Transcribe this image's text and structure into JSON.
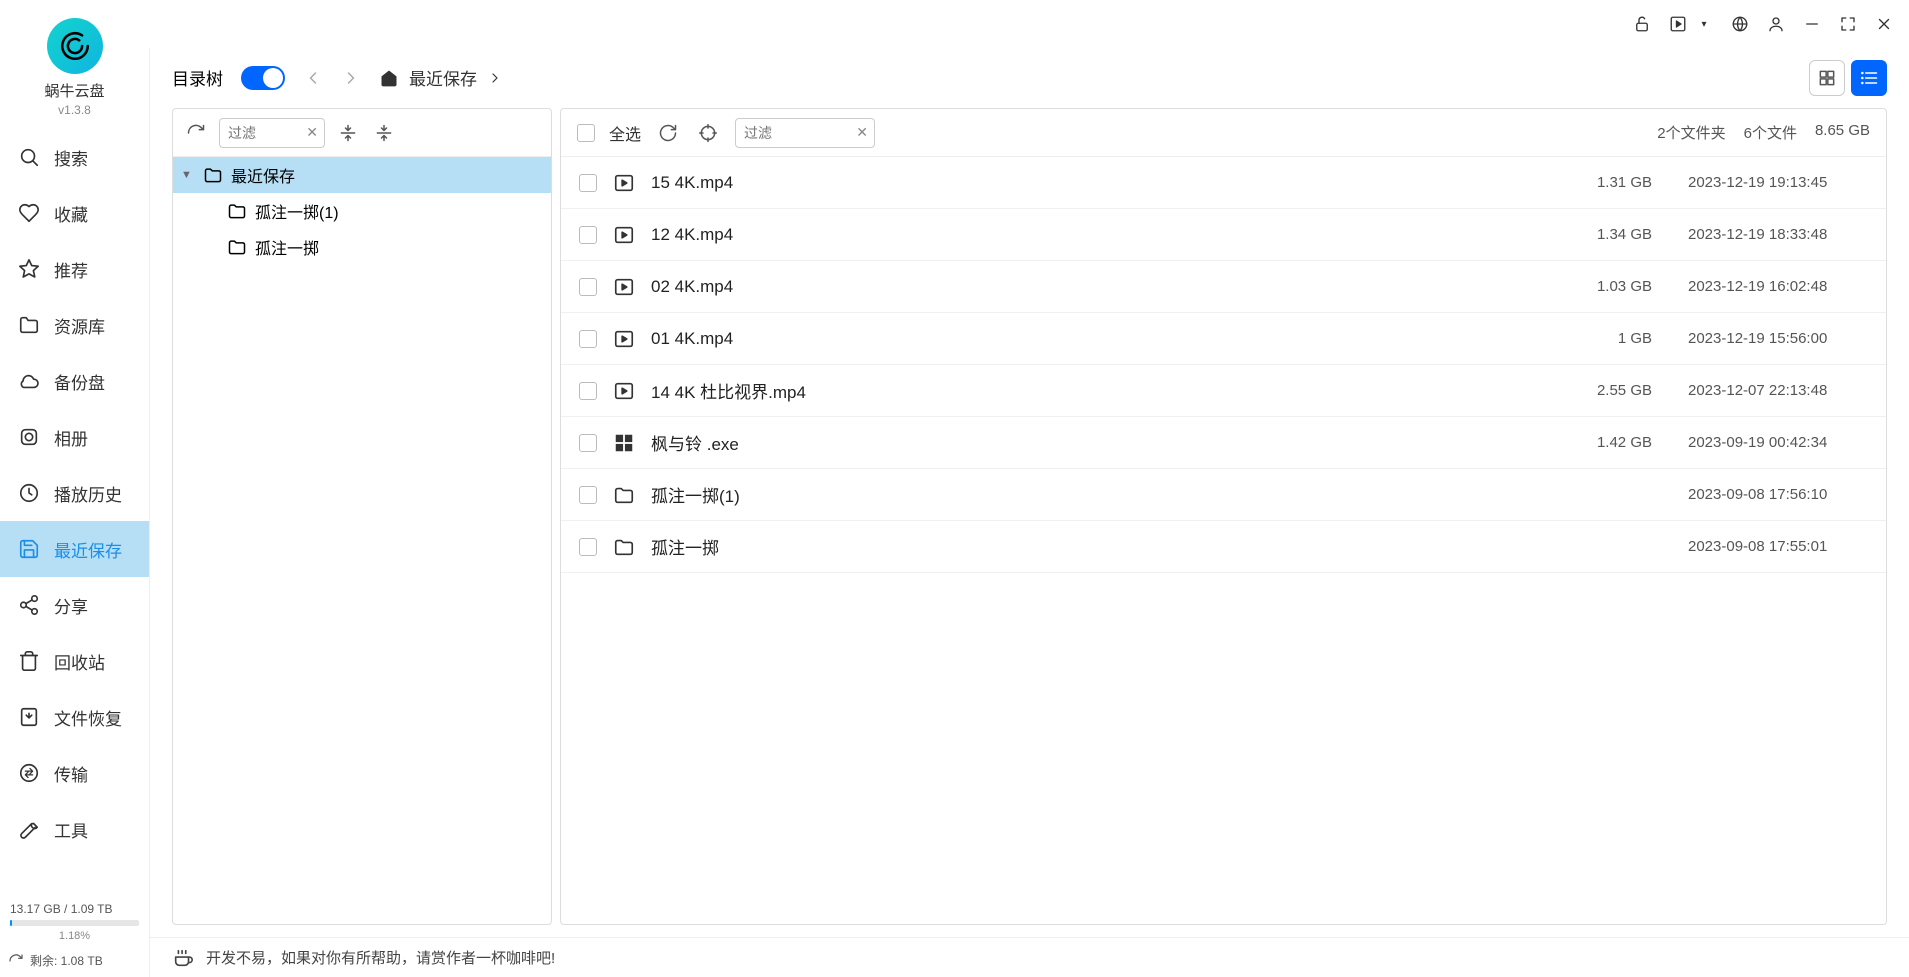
{
  "app": {
    "name": "蜗牛云盘",
    "version": "v1.3.8"
  },
  "titlebar": {},
  "sidebar": {
    "items": [
      {
        "label": "搜索",
        "icon": "search"
      },
      {
        "label": "收藏",
        "icon": "heart"
      },
      {
        "label": "推荐",
        "icon": "star"
      },
      {
        "label": "资源库",
        "icon": "folder"
      },
      {
        "label": "备份盘",
        "icon": "cloud"
      },
      {
        "label": "相册",
        "icon": "album"
      },
      {
        "label": "播放历史",
        "icon": "clock"
      },
      {
        "label": "最近保存",
        "icon": "save"
      },
      {
        "label": "分享",
        "icon": "share"
      },
      {
        "label": "回收站",
        "icon": "trash"
      },
      {
        "label": "文件恢复",
        "icon": "recover"
      },
      {
        "label": "传输",
        "icon": "transfer"
      },
      {
        "label": "工具",
        "icon": "wrench"
      }
    ],
    "storage": {
      "used": "13.17 GB / 1.09 TB",
      "percent": "1.18%",
      "percent_val": 1.18,
      "remain": "剩余:  1.08 TB"
    }
  },
  "topbar": {
    "tree_label": "目录树",
    "breadcrumb": "最近保存"
  },
  "tree": {
    "filter_placeholder": "过滤",
    "root": "最近保存",
    "children": [
      "孤注一掷(1)",
      "孤注一掷"
    ]
  },
  "files": {
    "select_all": "全选",
    "filter_placeholder": "过滤",
    "stats": {
      "folders": "2个文件夹",
      "files": "6个文件",
      "size": "8.65 GB"
    },
    "rows": [
      {
        "name": "15 4K.mp4",
        "type": "video",
        "size": "1.31 GB",
        "date": "2023-12-19 19:13:45"
      },
      {
        "name": "12 4K.mp4",
        "type": "video",
        "size": "1.34 GB",
        "date": "2023-12-19 18:33:48"
      },
      {
        "name": "02 4K.mp4",
        "type": "video",
        "size": "1.03 GB",
        "date": "2023-12-19 16:02:48"
      },
      {
        "name": "01 4K.mp4",
        "type": "video",
        "size": "1 GB",
        "date": "2023-12-19 15:56:00"
      },
      {
        "name": "14 4K 杜比视界.mp4",
        "type": "video",
        "size": "2.55 GB",
        "date": "2023-12-07 22:13:48"
      },
      {
        "name": "枫与铃 .exe",
        "type": "exe",
        "size": "1.42 GB",
        "date": "2023-09-19 00:42:34"
      },
      {
        "name": "孤注一掷(1)",
        "type": "folder",
        "size": "",
        "date": "2023-09-08 17:56:10"
      },
      {
        "name": "孤注一掷",
        "type": "folder",
        "size": "",
        "date": "2023-09-08 17:55:01"
      }
    ]
  },
  "footer": {
    "text": "开发不易，如果对你有所帮助，请赏作者一杯咖啡吧!"
  }
}
